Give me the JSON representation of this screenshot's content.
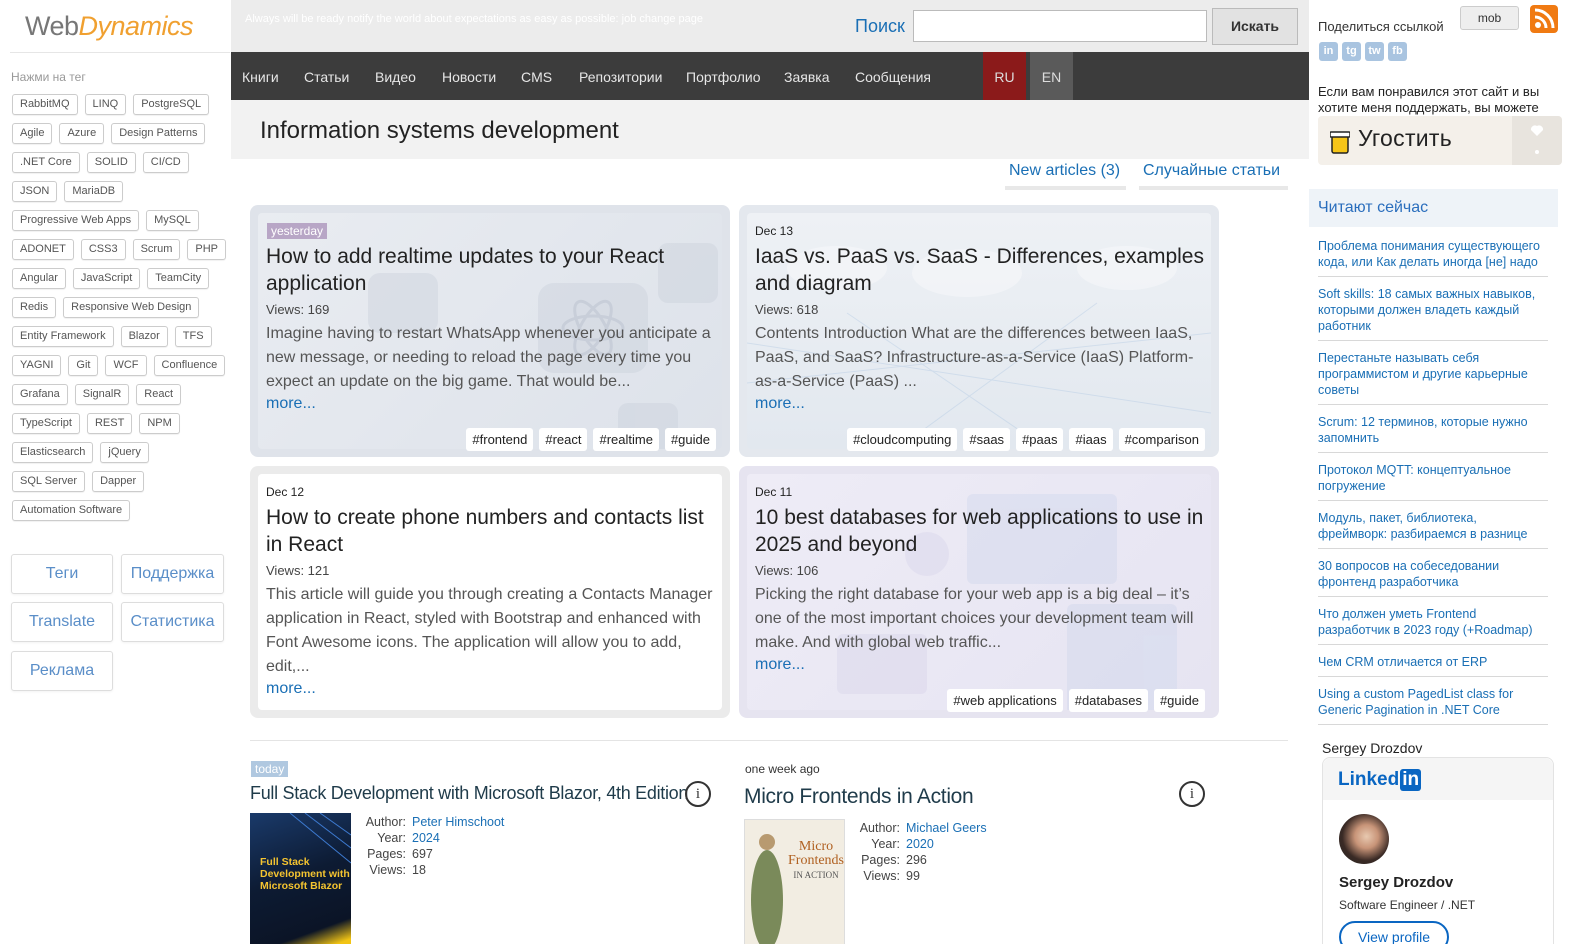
{
  "logo": {
    "part1": "Web",
    "part2": "Dynamics"
  },
  "header": {
    "tagline": "Always will be ready notify the world about expectations as easy as possible: job change page",
    "search_label": "Поиск",
    "search_value": "",
    "search_button": "Искать"
  },
  "nav": {
    "items": [
      "Книги",
      "Статьи",
      "Видео",
      "Новости",
      "CMS",
      "Репозитории",
      "Портфолио",
      "Заявка",
      "Сообщения"
    ],
    "lang_ru": "RU",
    "lang_en": "EN"
  },
  "page": {
    "title": "Information systems development",
    "tab_new": "New articles (3)",
    "tab_random": "Случайные статьи"
  },
  "sidebar": {
    "tag_hint": "Нажми на тег",
    "tags": [
      "RabbitMQ",
      "LINQ",
      "PostgreSQL",
      "Agile",
      "Azure",
      "Design Patterns",
      ".NET Core",
      "SOLID",
      "CI/CD",
      "JSON",
      "MariaDB",
      "Progressive Web Apps",
      "MySQL",
      "ADONET",
      "CSS3",
      "Scrum",
      "PHP",
      "Angular",
      "JavaScript",
      "TeamCity",
      "Redis",
      "Responsive Web Design",
      "Entity Framework",
      "Blazor",
      "TFS",
      "YAGNI",
      "Git",
      "WCF",
      "Confluence",
      "Grafana",
      "SignalR",
      "React",
      "TypeScript",
      "REST",
      "NPM",
      "Elasticsearch",
      "jQuery",
      "SQL Server",
      "Dapper",
      "Automation Software"
    ],
    "links": [
      "Теги",
      "Поддержка",
      "Translate",
      "Статистика",
      "Реклама"
    ]
  },
  "articles": [
    {
      "date": "yesterday",
      "title": "How to add realtime updates to your React application",
      "views": "Views: 169",
      "excerpt": "Imagine having to restart WhatsApp whenever you anticipate a new message, or needing to reload the page every time you expect an update on the big game. That would be...",
      "more": "more...",
      "tags": [
        "#frontend",
        "#react",
        "#realtime",
        "#guide"
      ]
    },
    {
      "date": "Dec 13",
      "title": "IaaS vs. PaaS vs. SaaS - Differences, examples and diagram",
      "views": "Views: 618",
      "excerpt": "Contents Introduction What are the differences between IaaS, PaaS, and SaaS? Infrastructure-as-a-Service (IaaS) Platform-as-a-Service (PaaS) ...",
      "more": "more...",
      "tags": [
        "#cloudcomputing",
        "#saas",
        "#paas",
        "#iaas",
        "#comparison"
      ]
    },
    {
      "date": "Dec 12",
      "title": "How to create phone numbers and contacts list in React",
      "views": "Views: 121",
      "excerpt": "This article will guide you through creating a Contacts Manager application in React, styled with Bootstrap and enhanced with Font Awesome icons. The application will allow you to add, edit,...",
      "more": "more...",
      "tags": []
    },
    {
      "date": "Dec 11",
      "title": "10 best databases for web applications to use in 2025 and beyond",
      "views": "Views: 106",
      "excerpt": "Picking the right database for your web app is a big deal – it’s one of the most important choices your development team will make. And with global web traffic...",
      "more": "more...",
      "tags": [
        "#web applications",
        "#databases",
        "#guide"
      ]
    }
  ],
  "books": [
    {
      "when": "today",
      "title": "Full Stack Development with Microsoft Blazor, 4th Edition",
      "cover_lines": [
        "Full Stack",
        "Development with",
        "Microsoft Blazor"
      ],
      "author_label": "Author:",
      "author": "Peter Himschoot",
      "year_label": "Year:",
      "year": "2024",
      "pages_label": "Pages:",
      "pages": "697",
      "views_label": "Views:",
      "views": "18"
    },
    {
      "when": "one week ago",
      "title": "Micro Frontends in Action",
      "cover_lines": [
        "Micro",
        "Frontends",
        "IN ACTION"
      ],
      "author_label": "Author:",
      "author": "Michael Geers",
      "year_label": "Year:",
      "year": "2020",
      "pages_label": "Pages:",
      "pages": "296",
      "views_label": "Views:",
      "views": "99"
    }
  ],
  "right": {
    "share_label": "Поделиться ссылкой",
    "mob": "mob",
    "social": [
      "in",
      "tg",
      "tw",
      "fb"
    ],
    "support_text": "Если вам понравился этот сайт и вы хотите меня поддержать, вы можете",
    "coffee": "Угостить",
    "reading_now": "Читают сейчас",
    "reading": [
      "Проблема понимания существующего кода, или Как делать иногда [не] надо",
      "Soft skills: 18 самых важных навыков, которыми должен владеть каждый работник",
      "Перестаньте называть себя программистом и другие карьерные советы",
      "Scrum: 12 терминов, которые нужно запомнить",
      "Протокол MQTT: концептуальное погружение",
      "Модуль, пакет, библиотека, фреймворк: разбираемся в разнице",
      "30 вопросов на собеседовании фронтенд разработчика",
      "Что должен уметь Frontend разработчик в 2023 году (+Roadmap)",
      "Чем CRM отличается от ERP",
      "Using a custom PagedList class for Generic Pagination in .NET Core"
    ],
    "author_name": "Sergey Drozdov",
    "linkedin_word": "Linked",
    "linkedin_in": "in",
    "linkedin_name": "Sergey Drozdov",
    "linkedin_role": "Software Engineer / .NET",
    "linkedin_button": "View profile"
  },
  "colors": {
    "nav_bg": "#3c3c3c",
    "lang_ru": "#8b1a1a",
    "link": "#1a6fb5",
    "logo_accent": "#f0a030"
  }
}
